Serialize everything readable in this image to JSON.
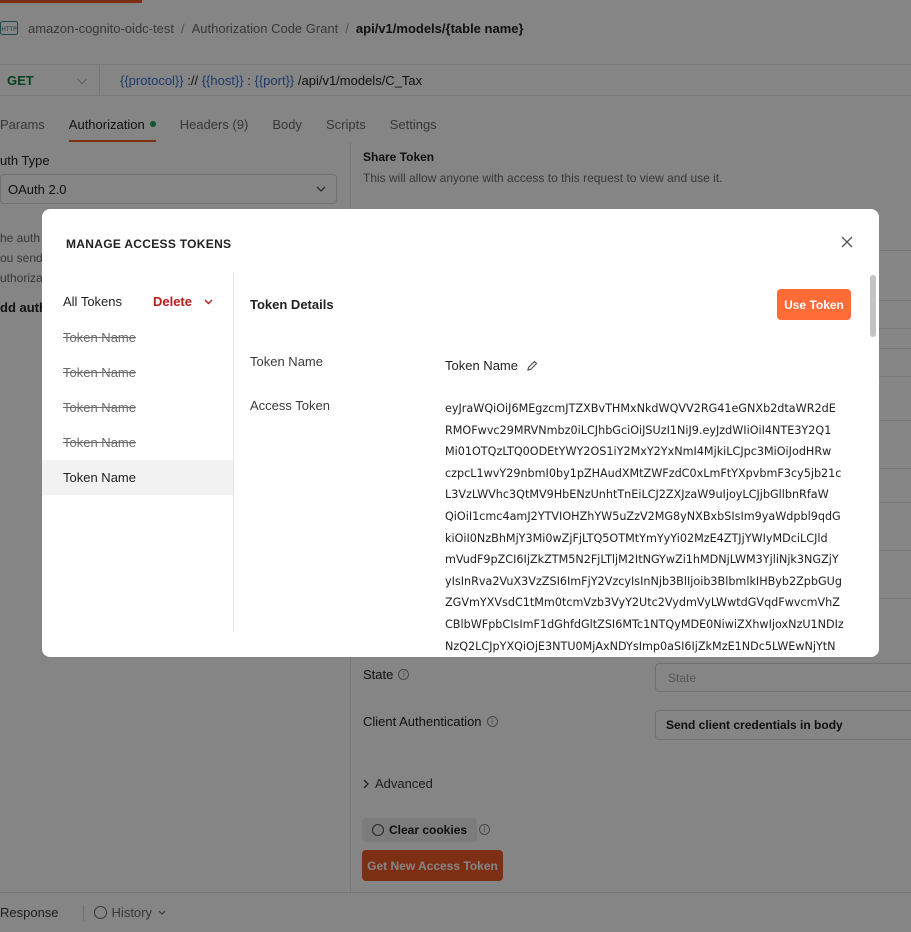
{
  "breadcrumb": {
    "collection": "amazon-cognito-oidc-test",
    "folder": "Authorization Code Grant",
    "request": "api/v1/models/{table name}"
  },
  "url_bar": {
    "method": "GET",
    "var_protocol": "{{protocol}}",
    "sep1": " :// ",
    "var_host": "{{host}}",
    "sep2": " : ",
    "var_port": "{{port}}",
    "path": " /api/v1/models/C_Tax"
  },
  "request_tabs": [
    "Params",
    "Authorization",
    "Headers (9)",
    "Body",
    "Scripts",
    "Settings"
  ],
  "auth": {
    "type_label": "uth Type",
    "type_value": "OAuth 2.0",
    "desc_lines": [
      "he auth",
      "ou send",
      "uthoriza"
    ],
    "add_auth": "dd auth"
  },
  "share": {
    "title": "Share Token",
    "desc": "This will allow anyone with access to this request to view and use it."
  },
  "form": {
    "state_label": "State",
    "state_placeholder": "State",
    "client_auth_label": "Client Authentication",
    "client_auth_value": "Send client credentials in body",
    "advanced": "Advanced",
    "clear_cookies": "Clear cookies",
    "get_token": "Get New Access Token"
  },
  "bottom": {
    "response": "Response",
    "history": "History"
  },
  "modal": {
    "title": "MANAGE ACCESS TOKENS",
    "all_tokens": "All Tokens",
    "delete": "Delete",
    "tokens": [
      {
        "name": "Token Name",
        "expired": true
      },
      {
        "name": "Token Name",
        "expired": true
      },
      {
        "name": "Token Name",
        "expired": true
      },
      {
        "name": "Token Name",
        "expired": true
      },
      {
        "name": "Token Name",
        "expired": false,
        "selected": true
      }
    ],
    "details_title": "Token Details",
    "use_token": "Use Token",
    "token_name_label": "Token Name",
    "token_name_value": "Token Name",
    "access_token_label": "Access Token",
    "access_token_lines": [
      "eyJraWQiOiJ6MEgzcmJTZXBvTHMxNkdWQVV2RG41eGNXb2dtaWR2dE",
      "RMOFwvc29MRVNmbz0iLCJhbGciOiJSUzI1NiJ9.eyJzdWIiOiI4NTE3Y2Q1",
      "Mi01OTQzLTQ0ODEtYWY2OS1iY2MxY2YxNmI4MjkiLCJpc3MiOiJodHRw",
      "czpcL1wvY29nbmI0by1pZHAudXMtZWFzdC0xLmFtYXpvbmF3cy5jb21c",
      "L3VzLWVhc3QtMV9HbENzUnhtTnEiLCJ2ZXJzaW9uIjoyLCJjbGllbnRfaW",
      "QiOiI1cmc4amJ2YTVIOHZhYW5uZzV2MG8yNXBxbSIsIm9yaWdpbl9qdG",
      "kiOiI0NzBhMjY3Mi0wZjFjLTQ5OTMtYmYyYi02MzE4ZTJjYWIyMDciLCJld",
      "mVudF9pZCI6IjZkZTM5N2FjLTljM2ItNGYwZi1hMDNjLWM3YjliNjk3NGZjY",
      "yIsInRva2VuX3VzZSI6ImFjY2VzcyIsInNjb3BlIjoib3BlbmlkIHByb2ZpbGUg",
      "ZGVmYXVsdC1tMm0tcmVzb3VyY2Utc2VydmVyLWwtdGVqdFwvcmVhZ",
      "CBlbWFpbCIsImF1dGhfdGltZSI6MTc1NTQyMDE0NiwiZXhwIjoxNzU1NDIz",
      "NzQ2LCJpYXQiOjE3NTU0MjAxNDYsImp0aSI6IjZkMzE1NDc5LWEwNjYtN"
    ]
  }
}
